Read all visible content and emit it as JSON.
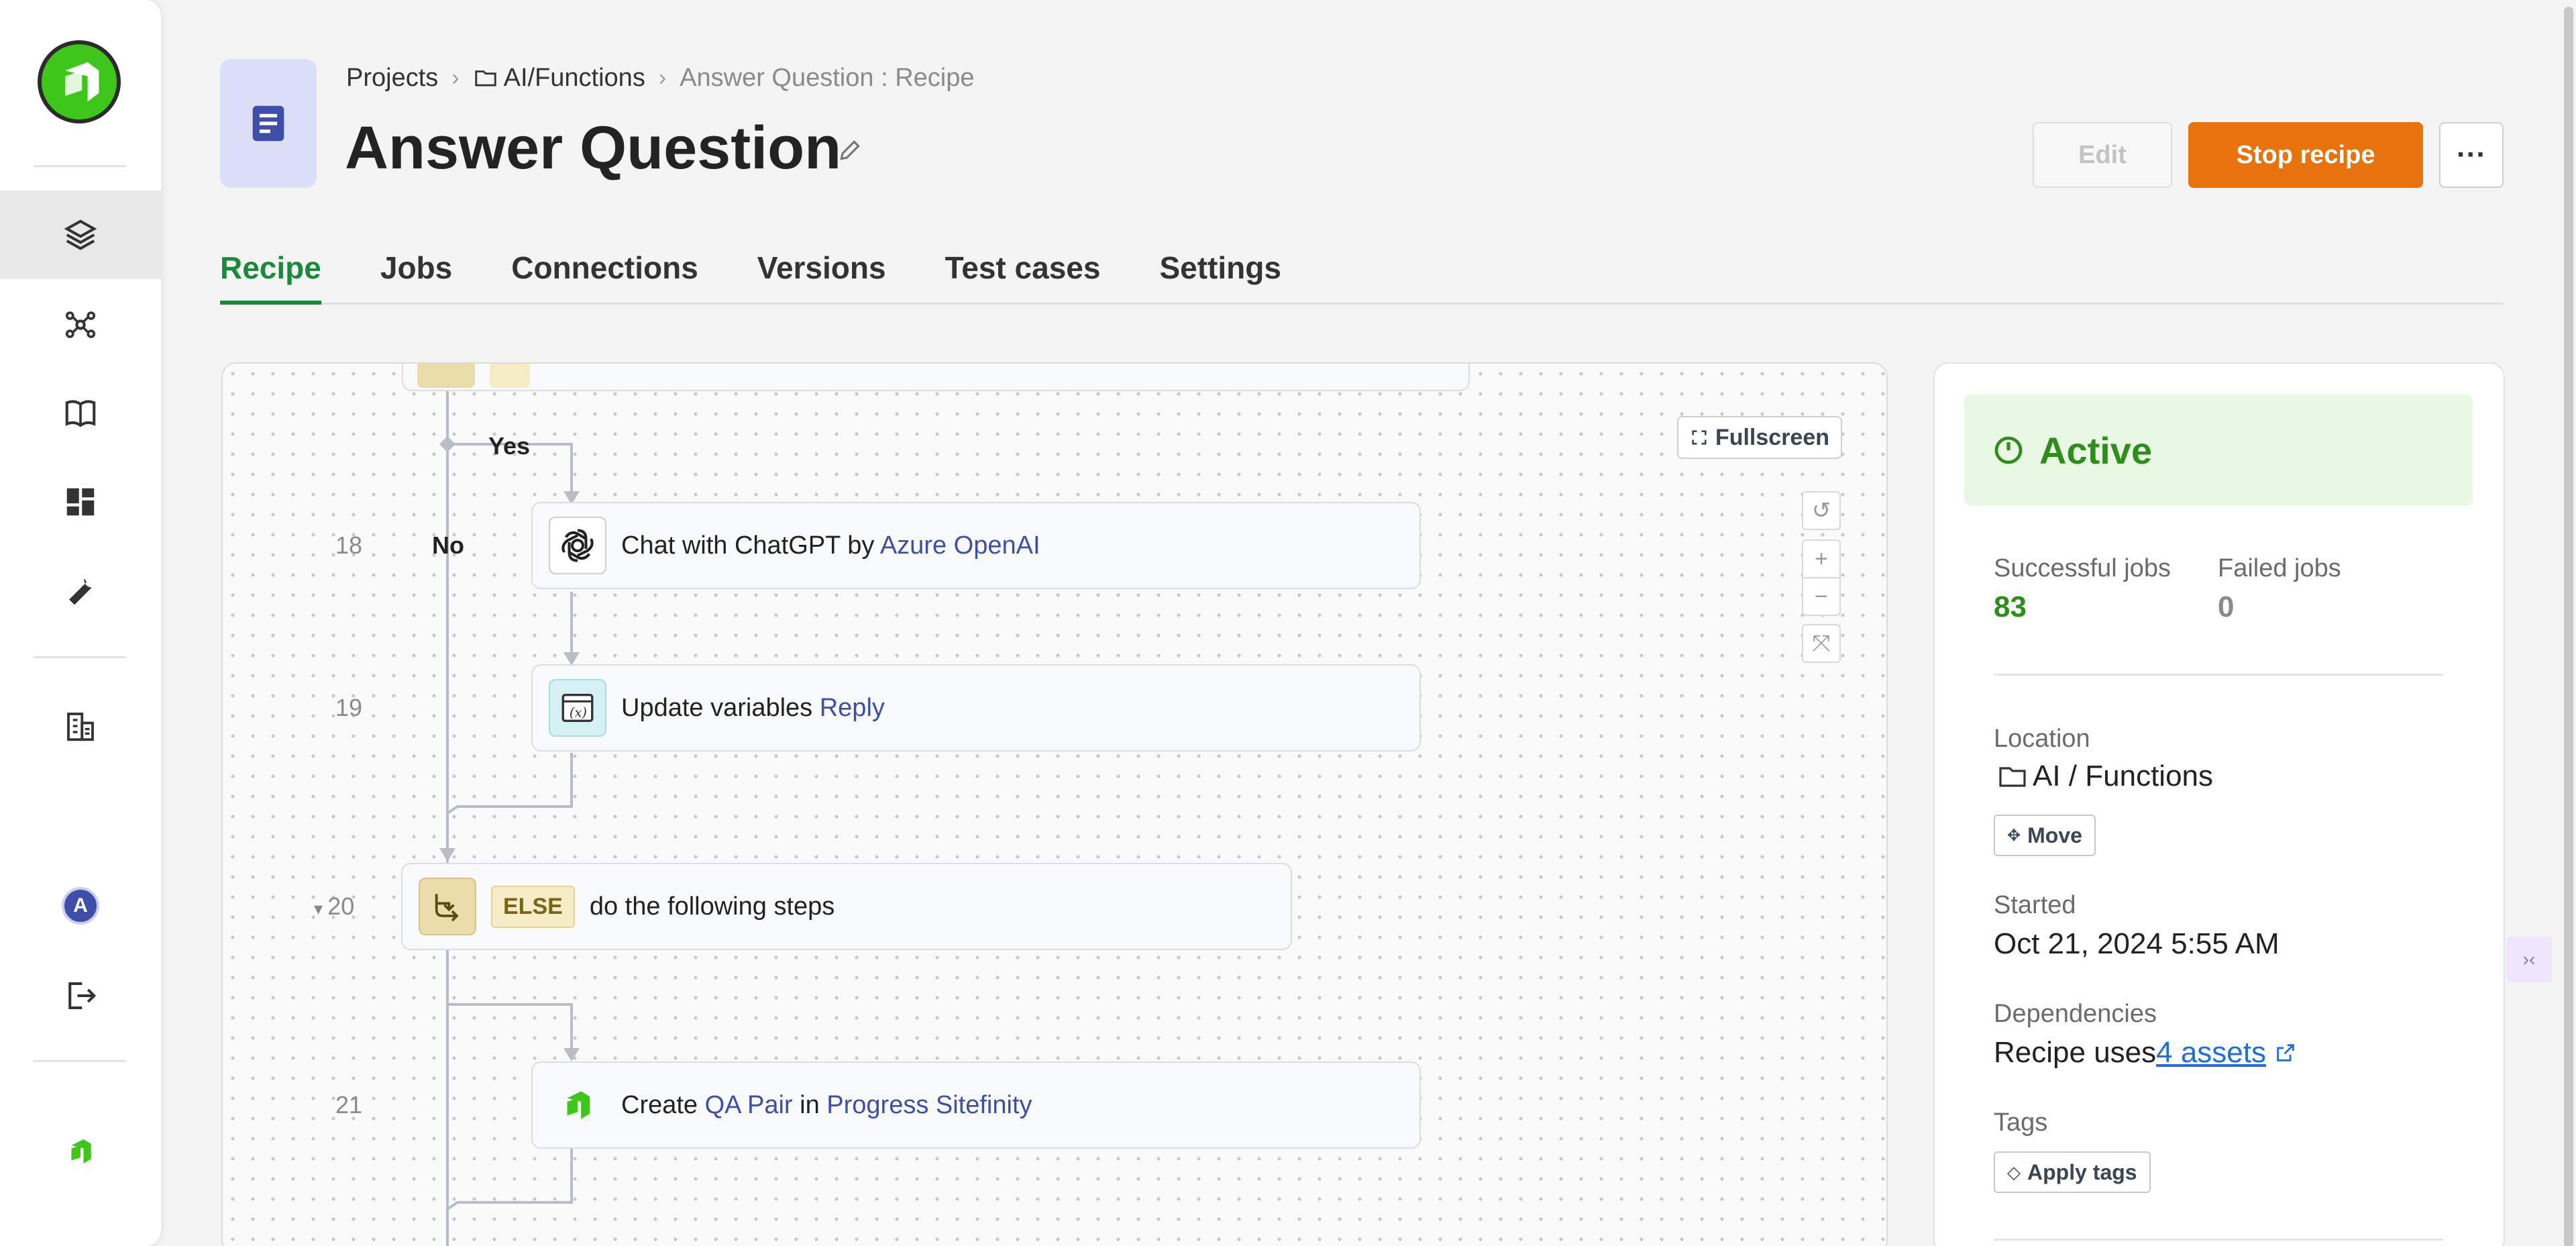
{
  "breadcrumb": {
    "projects": "Projects",
    "folder": "AI/Functions",
    "current": "Answer Question : Recipe"
  },
  "header": {
    "title": "Answer Question",
    "edit_label": "Edit",
    "stop_label": "Stop recipe",
    "more_label": "···"
  },
  "tabs": [
    {
      "label": "Recipe",
      "active": true
    },
    {
      "label": "Jobs"
    },
    {
      "label": "Connections"
    },
    {
      "label": "Versions"
    },
    {
      "label": "Test cases"
    },
    {
      "label": "Settings"
    }
  ],
  "canvas": {
    "fullscreen_label": "Fullscreen",
    "yes_label": "Yes",
    "no_label": "No",
    "steps": [
      {
        "number": "18",
        "prefix": "Chat with ChatGPT by ",
        "link": "Azure OpenAI"
      },
      {
        "number": "19",
        "prefix": "Update variables ",
        "link": "Reply"
      },
      {
        "number": "20",
        "tag": "ELSE",
        "text": "do the following steps"
      },
      {
        "number": "21",
        "prefix": "Create ",
        "link": "QA Pair",
        "mid": " in ",
        "link2": "Progress Sitefinity"
      }
    ]
  },
  "panel": {
    "status": "Active",
    "successful_label": "Successful jobs",
    "successful_value": "83",
    "failed_label": "Failed jobs",
    "failed_value": "0",
    "location_label": "Location",
    "location_value": "AI / Functions",
    "move_label": "Move",
    "started_label": "Started",
    "started_value": "Oct 21, 2024 5:55 AM",
    "dependencies_label": "Dependencies",
    "dependencies_prefix": "Recipe uses ",
    "dependencies_link": "4 assets",
    "tags_label": "Tags",
    "apply_tags_label": "Apply tags"
  },
  "colors": {
    "accent_green": "#1a8a3a",
    "stop_orange": "#e8720c",
    "active_bg": "#e8f8e2",
    "link_blue": "#3f4ea8"
  }
}
